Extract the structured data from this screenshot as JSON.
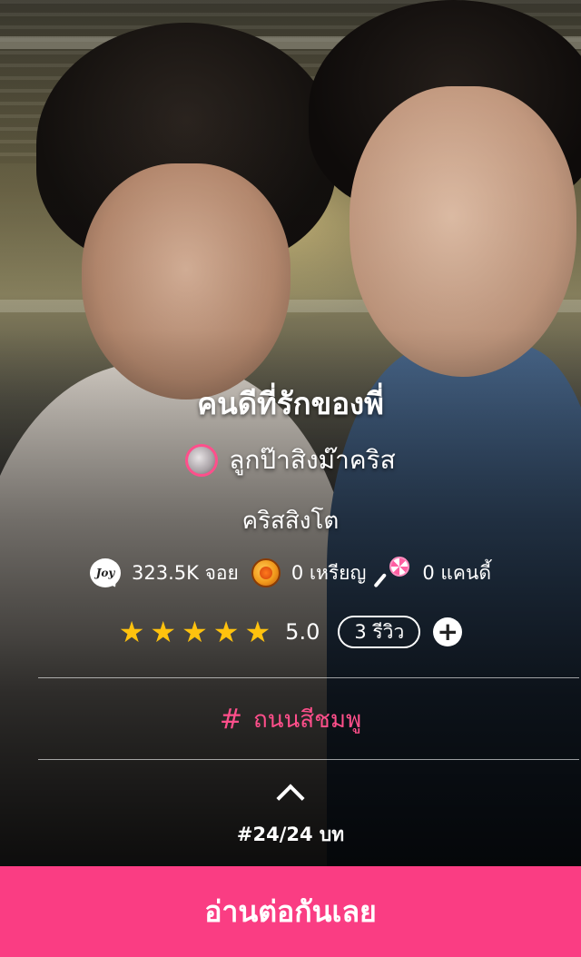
{
  "story": {
    "title": "คนดีที่รักของพี่",
    "author": "ลูกป๊าสิงม๊าคริส",
    "subtitle": "คริสสิงโต"
  },
  "stats": {
    "joy": {
      "icon": "joy-icon",
      "badge_text": "Joy",
      "label": "323.5K จอย"
    },
    "coins": {
      "icon": "coin-icon",
      "label": "0 เหรียญ"
    },
    "candy": {
      "icon": "candy-icon",
      "label": "0 แคนดี้"
    }
  },
  "rating": {
    "stars": 5,
    "value": "5.0",
    "reviews_label": "3 รีวิว",
    "add_symbol": "+"
  },
  "tag": {
    "icon": "hashtag-icon",
    "symbol": "#",
    "label": "ถนนสีชมพู"
  },
  "episode": {
    "label": "#24/24 บท"
  },
  "cta": {
    "label": "อ่านต่อกันเลย"
  },
  "colors": {
    "accent": "#fa3d83",
    "tag": "#ff4f8b",
    "star": "#ffc20e"
  }
}
